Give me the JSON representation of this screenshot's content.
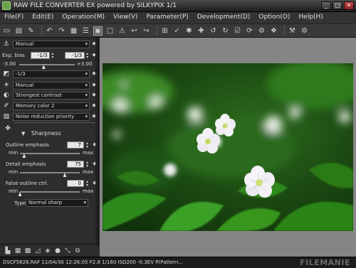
{
  "window": {
    "title": "RAW FILE CONVERTER EX powered by SILKYPIX   1/1",
    "minimize": "_",
    "maximize": "□",
    "close": "✕"
  },
  "menu": [
    "File(F)",
    "Edit(E)",
    "Operation(M)",
    "View(V)",
    "Parameter(P)",
    "Development(D)",
    "Option(O)",
    "Help(H)"
  ],
  "toolbar": {
    "icons": [
      "open-folder-icon",
      "folder-icon",
      "eraser-icon",
      "undo-icon",
      "redo-icon",
      "grid-view-icon",
      "list-view-icon",
      "single-view-icon",
      "fullscreen-icon",
      "warning-icon",
      "prev-icon",
      "next-icon",
      "crop-icon",
      "eyedropper-icon",
      "white-balance-icon",
      "tone-icon",
      "rotate-left-icon",
      "rotate-right-icon",
      "check-icon",
      "refresh-icon",
      "develop-icon",
      "batch-icon",
      "hammer-icon",
      "settings-icon"
    ]
  },
  "panel": {
    "wb_mode": "Manual",
    "exposure": {
      "label": "Exp. bias",
      "value": "-1/3",
      "value2": "-1/3",
      "min": "-3.00",
      "max": "+3.00",
      "level": 0.44
    },
    "exp_preset": "-1/3",
    "tone_mode": "Manual",
    "contrast": "Strongest contrast",
    "color": "Memory color 2",
    "noise": "Noise reduction priority",
    "sharpness": {
      "title": "Sharpness",
      "outline_label": "Outline emphasis",
      "outline_value": "7",
      "outline_level": 0.07,
      "detail_label": "Detail emphasis",
      "detail_value": "75",
      "detail_level": 0.75,
      "false_label": "False outline ctrl.",
      "false_value": "0",
      "false_level": 0.0,
      "min": "min",
      "max": "max",
      "type_label": "Type",
      "type_value": "Normal sharp"
    }
  },
  "statusbar": {
    "text": "DSCF5626.RAF 11/04/30 12:26:05 F2.8 1/160 ISO200 -0.3EV P(Pattern...",
    "watermark": "FILEMANIE"
  },
  "colors": {
    "accent": "#6ba34d",
    "photo_green": "#1c4b12",
    "flower": "#f2f0f5"
  }
}
